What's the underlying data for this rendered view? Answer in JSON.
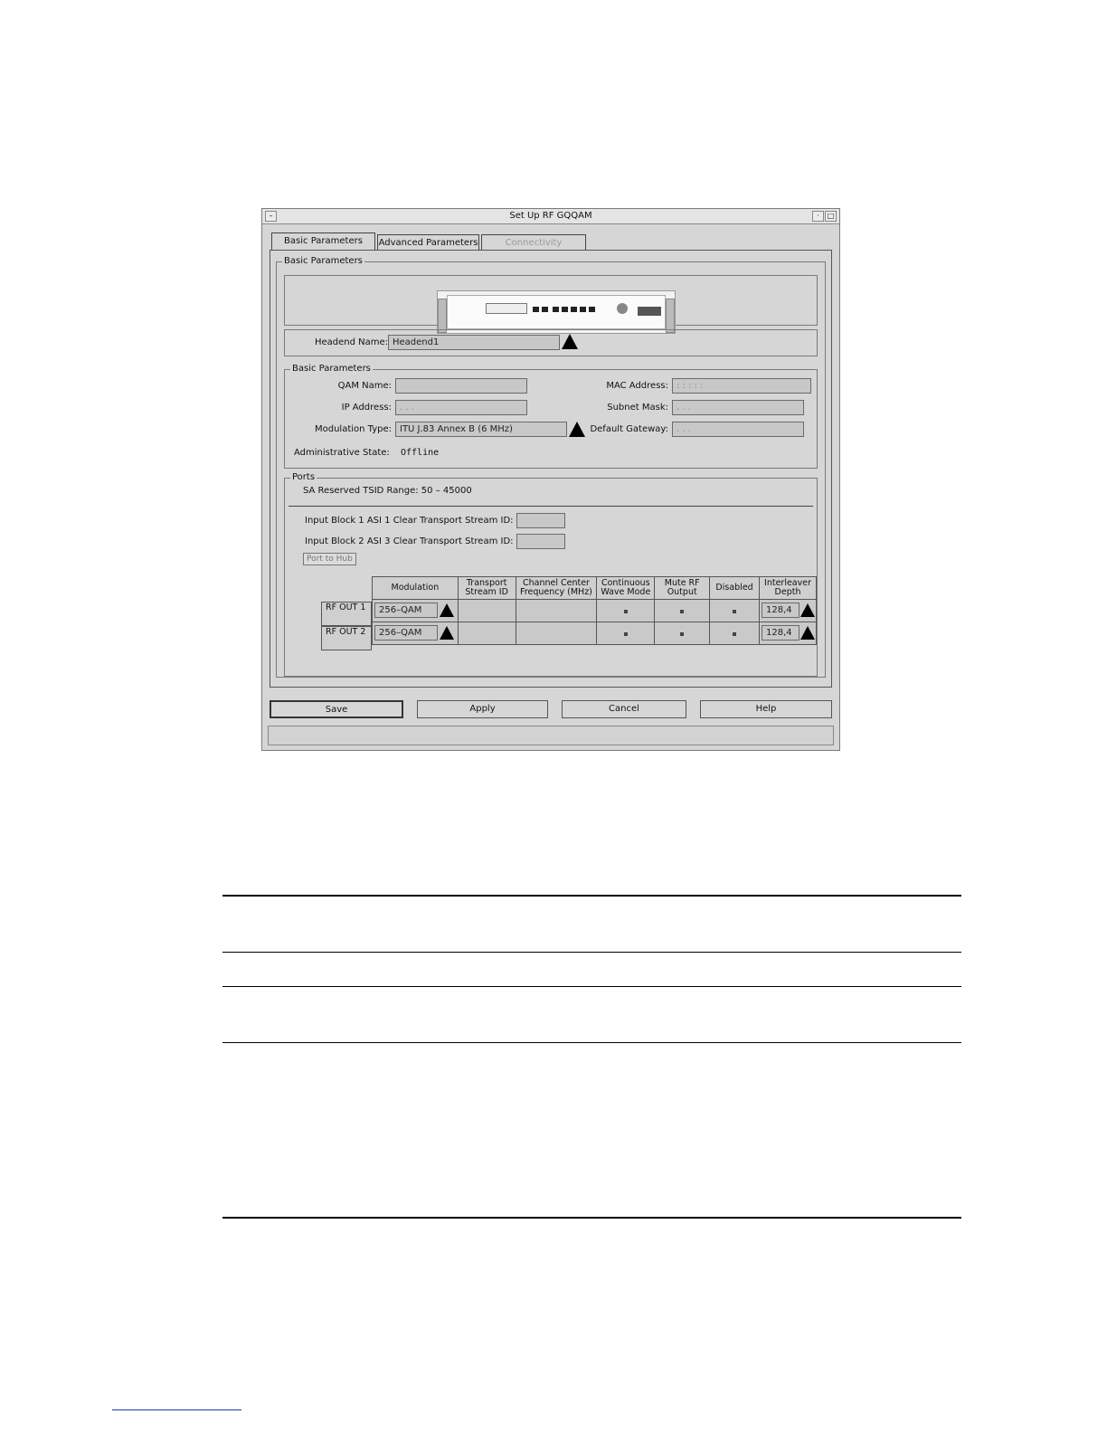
{
  "window": {
    "title": "Set Up RF GQQAM",
    "menu_glyph": "–",
    "min_glyph": "·",
    "max_glyph": "□"
  },
  "tabs": [
    {
      "label": "Basic Parameters",
      "state": "active"
    },
    {
      "label": "Advanced Parameters",
      "state": "normal"
    },
    {
      "label": "Connectivity",
      "state": "disabled"
    }
  ],
  "outer_group": {
    "title": "Basic Parameters"
  },
  "headend": {
    "label": "Headend Name:",
    "value": "Headend1"
  },
  "basic": {
    "title": "Basic Parameters",
    "qam_name_label": "QAM Name:",
    "qam_name_value": "",
    "ip_address_label": "IP Address:",
    "ip_address_value": ". . .",
    "modulation_type_label": "Modulation Type:",
    "modulation_type_value": "ITU J.83 Annex B (6 MHz)",
    "admin_state_label": "Administrative State:",
    "admin_state_value": "Offline",
    "mac_address_label": "MAC Address:",
    "mac_address_value": ": : : : :",
    "subnet_mask_label": "Subnet Mask:",
    "subnet_mask_value": ". . .",
    "default_gateway_label": "Default Gateway:",
    "default_gateway_value": ". . ."
  },
  "ports": {
    "title": "Ports",
    "tsid_range": "SA Reserved TSID Range: 50 – 45000",
    "input_block_1_label": "Input Block 1 ASI 1 Clear Transport Stream ID:",
    "input_block_1_value": "",
    "input_block_2_label": "Input Block 2 ASI 3 Clear Transport Stream ID:",
    "input_block_2_value": "",
    "port_to_hub_label": "Port to Hub",
    "columns": {
      "modulation": "Modulation",
      "tsid_1": "Transport",
      "tsid_2": "Stream ID",
      "freq_1": "Channel Center",
      "freq_2": "Frequency (MHz)",
      "cw_1": "Continuous",
      "cw_2": "Wave Mode",
      "mute_1": "Mute RF",
      "mute_2": "Output",
      "disabled": "Disabled",
      "depth_1": "Interleaver",
      "depth_2": "Depth"
    },
    "rows": [
      {
        "label": "RF OUT 1",
        "modulation": "256–QAM",
        "tsid": "",
        "frequency": "",
        "depth": "128,4"
      },
      {
        "label": "RF OUT 2",
        "modulation": "256–QAM",
        "tsid": "",
        "frequency": "",
        "depth": "128,4"
      }
    ]
  },
  "buttons": {
    "save": "Save",
    "apply": "Apply",
    "cancel": "Cancel",
    "help": "Help"
  }
}
